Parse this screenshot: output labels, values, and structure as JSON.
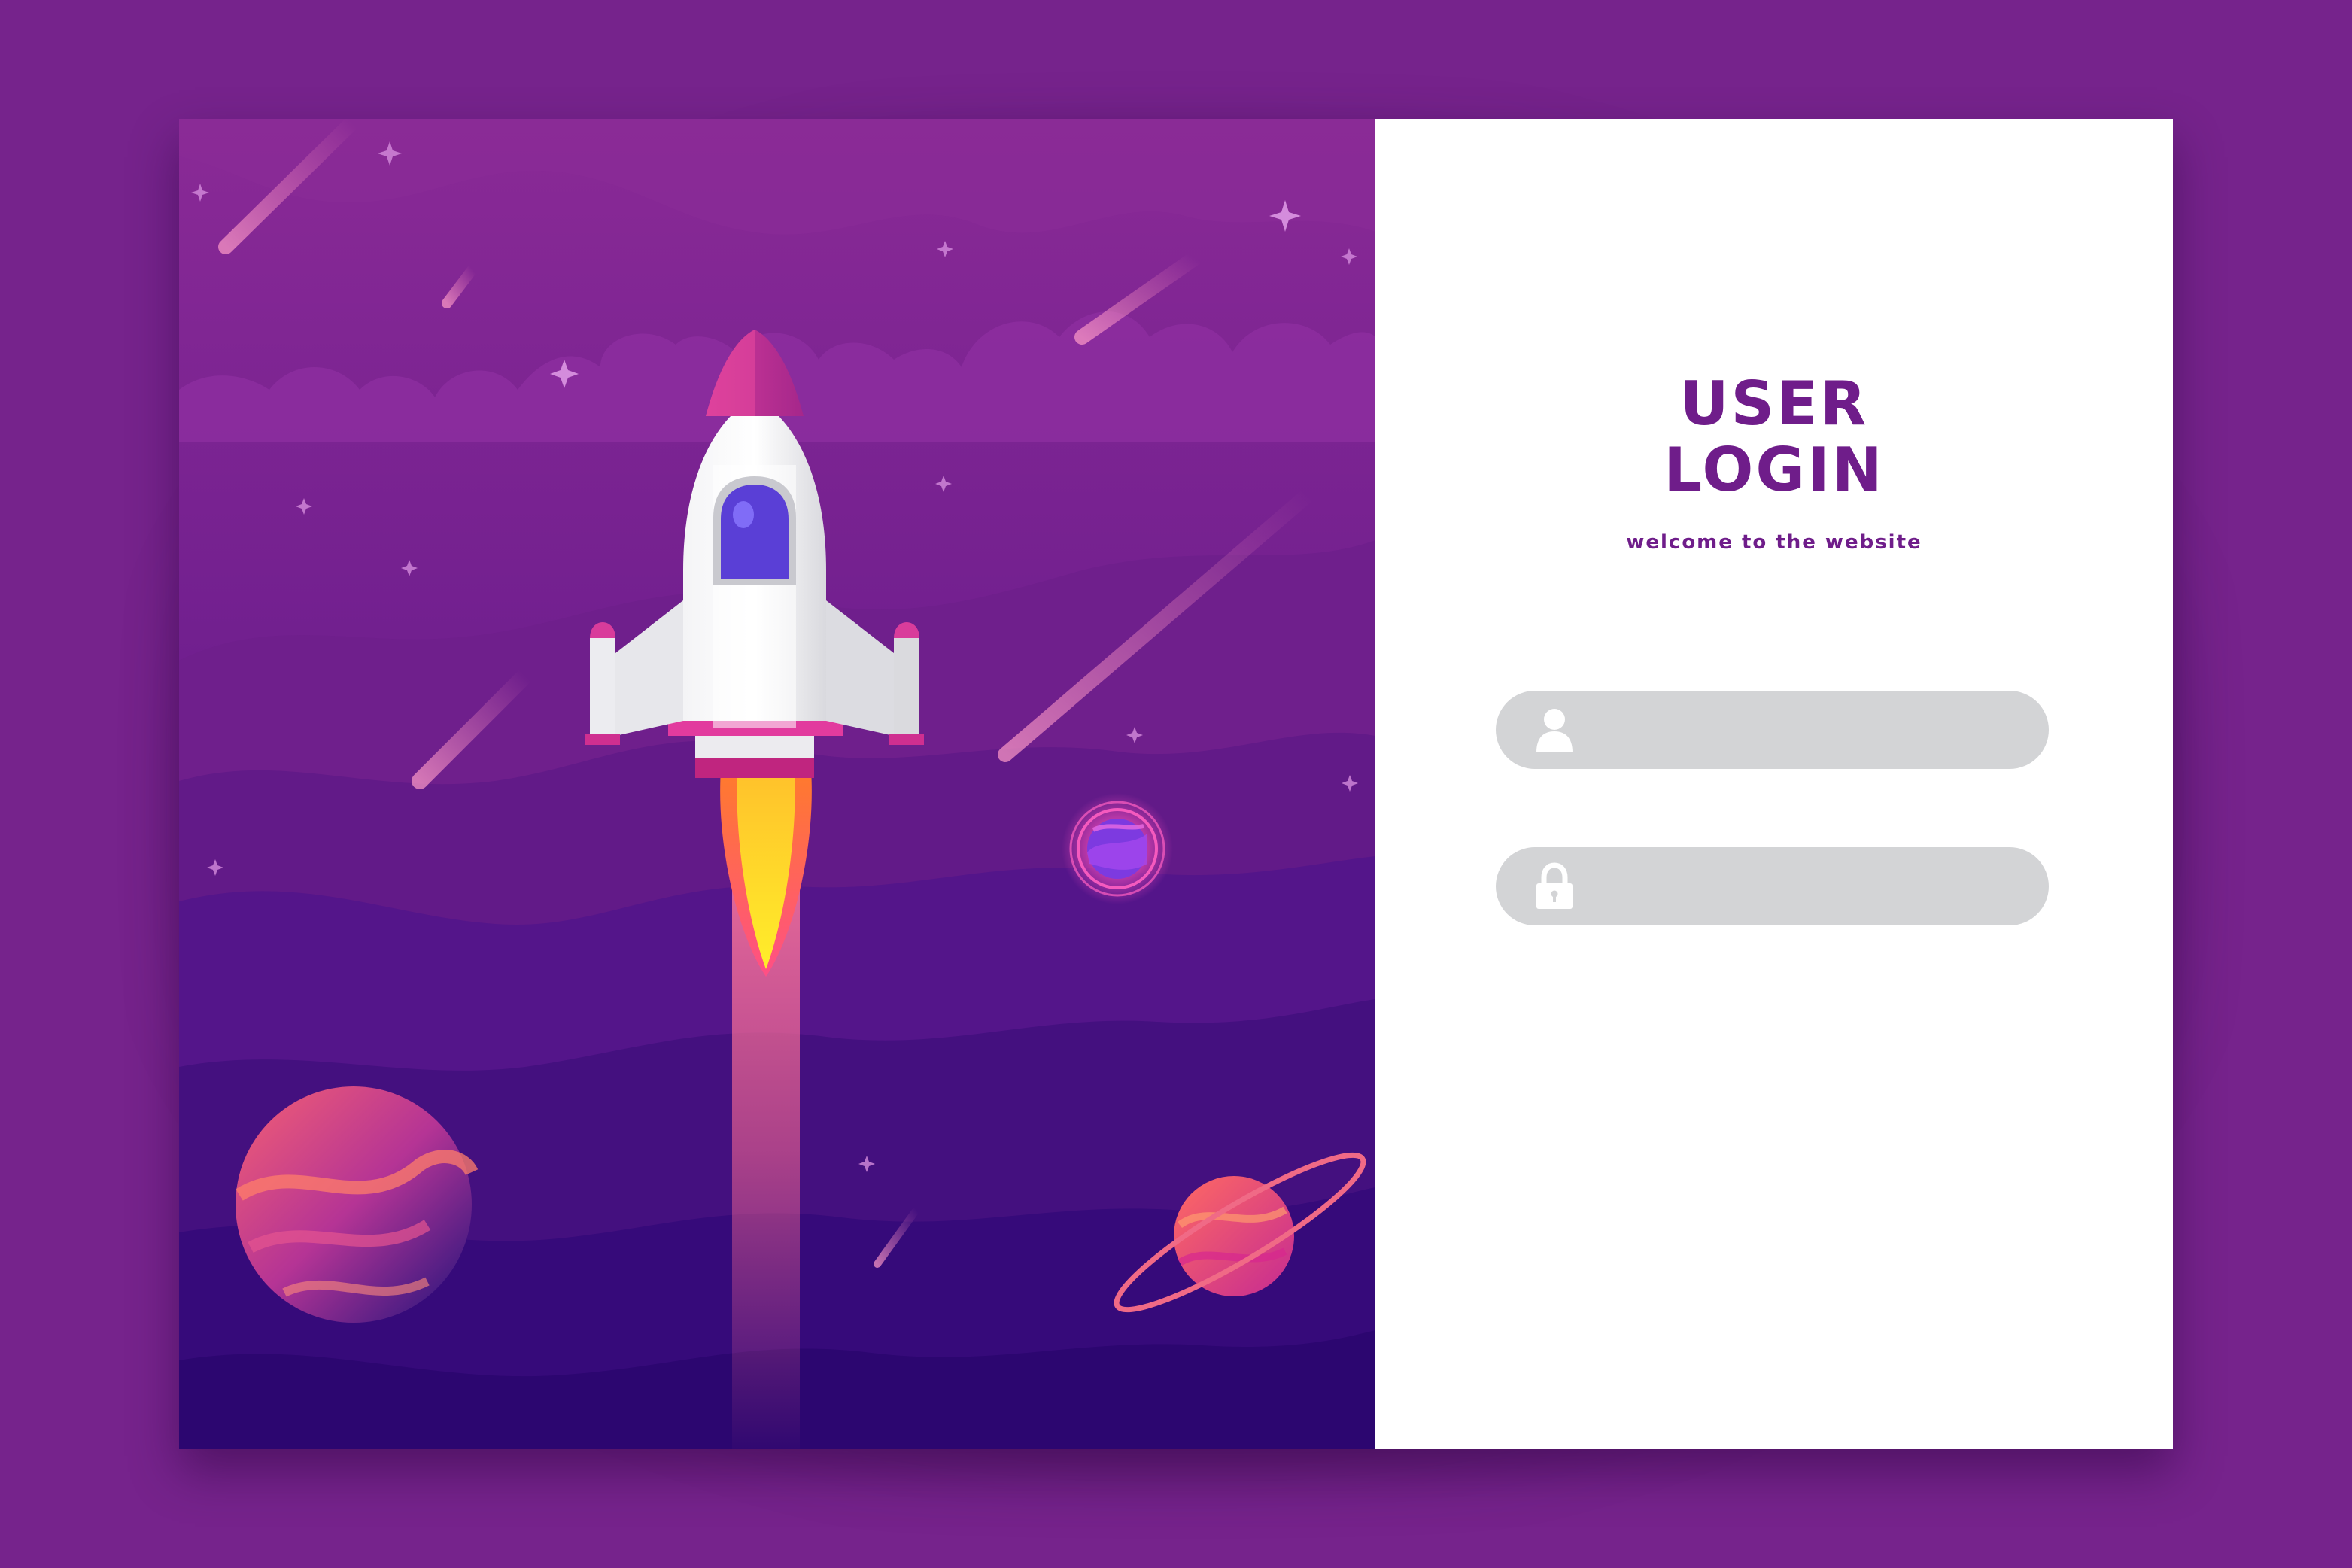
{
  "login": {
    "title_line1": "USER",
    "title_line2": "LOGIN",
    "subtitle": "welcome to the website",
    "username_value": "",
    "password_value": ""
  },
  "icons": {
    "username_field": "user-icon",
    "password_field": "lock-icon"
  },
  "colors": {
    "background": "#76238c",
    "accent": "#6f1d8a",
    "field_fill": "#d3d4d6",
    "panel": "#ffffff"
  }
}
